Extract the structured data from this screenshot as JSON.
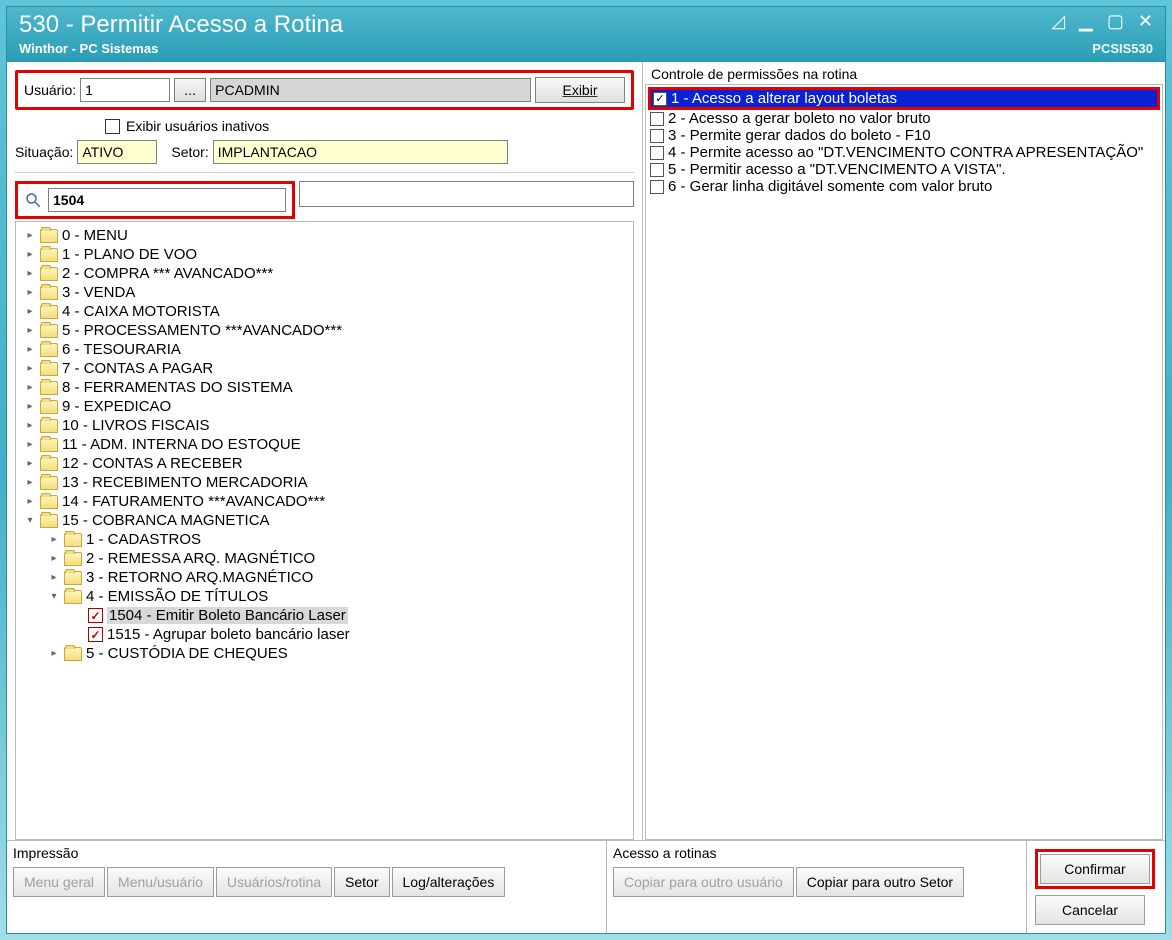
{
  "title": "530 - Permitir Acesso a Rotina",
  "subtitle": "Winthor - PC Sistemas",
  "module_code": "PCSIS530",
  "user_section": {
    "label": "Usuário:",
    "id": "1",
    "pick_label": "...",
    "name": "PCADMIN",
    "exibir_label": "Exibir",
    "inactive_label": "Exibir usuários inativos"
  },
  "situacao": {
    "label": "Situação:",
    "value": "ATIVO",
    "setor_label": "Setor:",
    "setor_value": "IMPLANTACAO"
  },
  "search_value": "1504",
  "tree": [
    {
      "lvl": 1,
      "exp": ">",
      "label": "0 - MENU"
    },
    {
      "lvl": 1,
      "exp": ">",
      "label": "1 - PLANO DE VOO"
    },
    {
      "lvl": 1,
      "exp": ">",
      "label": "2 - COMPRA          *** AVANCADO***"
    },
    {
      "lvl": 1,
      "exp": ">",
      "label": "3 - VENDA"
    },
    {
      "lvl": 1,
      "exp": ">",
      "label": "4 - CAIXA MOTORISTA"
    },
    {
      "lvl": 1,
      "exp": ">",
      "label": "5 - PROCESSAMENTO ***AVANCADO***"
    },
    {
      "lvl": 1,
      "exp": ">",
      "label": "6 - TESOURARIA"
    },
    {
      "lvl": 1,
      "exp": ">",
      "label": "7 - CONTAS A PAGAR"
    },
    {
      "lvl": 1,
      "exp": ">",
      "label": "8 - FERRAMENTAS DO SISTEMA"
    },
    {
      "lvl": 1,
      "exp": ">",
      "label": "9 - EXPEDICAO"
    },
    {
      "lvl": 1,
      "exp": ">",
      "label": "10 - LIVROS FISCAIS"
    },
    {
      "lvl": 1,
      "exp": ">",
      "label": "11 - ADM. INTERNA DO ESTOQUE"
    },
    {
      "lvl": 1,
      "exp": ">",
      "label": "12 - CONTAS A RECEBER"
    },
    {
      "lvl": 1,
      "exp": ">",
      "label": "13 - RECEBIMENTO MERCADORIA"
    },
    {
      "lvl": 1,
      "exp": ">",
      "label": "14 - FATURAMENTO    ***AVANCADO***"
    },
    {
      "lvl": 1,
      "exp": "v",
      "label": "15 - COBRANCA MAGNETICA"
    },
    {
      "lvl": 2,
      "exp": ">",
      "label": "1 - CADASTROS"
    },
    {
      "lvl": 2,
      "exp": ">",
      "label": "2 - REMESSA ARQ. MAGNÉTICO"
    },
    {
      "lvl": 2,
      "exp": ">",
      "label": "3 - RETORNO ARQ.MAGNÉTICO"
    },
    {
      "lvl": 2,
      "exp": "v",
      "label": "4 - EMISSÃO DE TÍTULOS"
    },
    {
      "lvl": 3,
      "chk": true,
      "sel": true,
      "label": "1504 - Emitir Boleto Bancário Laser"
    },
    {
      "lvl": 3,
      "chk": true,
      "label": "1515 - Agrupar boleto bancário laser"
    },
    {
      "lvl": 2,
      "exp": ">",
      "label": "5 - CUSTÓDIA DE CHEQUES",
      "cut": true
    }
  ],
  "permissions": {
    "title": "Controle de permissões na rotina",
    "items": [
      {
        "checked": true,
        "sel": true,
        "label": "1 - Acesso a alterar layout boletas"
      },
      {
        "checked": false,
        "label": "2 - Acesso a gerar boleto no valor bruto"
      },
      {
        "checked": false,
        "label": "3 - Permite gerar dados do boleto - F10"
      },
      {
        "checked": false,
        "label": "4 - Permite acesso ao \"DT.VENCIMENTO CONTRA APRESENTAÇÃO\""
      },
      {
        "checked": false,
        "label": "5 - Permitir acesso a \"DT.VENCIMENTO A VISTA\"."
      },
      {
        "checked": false,
        "label": "6 - Gerar linha digitável somente com valor bruto"
      }
    ]
  },
  "footer": {
    "impressao": {
      "title": "Impressão",
      "buttons": {
        "menu_geral": "Menu geral",
        "menu_usuario": "Menu/usuário",
        "usuarios_rotina": "Usuários/rotina",
        "setor": "Setor",
        "log": "Log/alterações"
      }
    },
    "acesso": {
      "title": "Acesso a rotinas",
      "copiar_usuario": "Copiar para outro usuário",
      "copiar_setor": "Copiar para outro Setor"
    },
    "confirmar": "Confirmar",
    "cancelar": "Cancelar"
  }
}
